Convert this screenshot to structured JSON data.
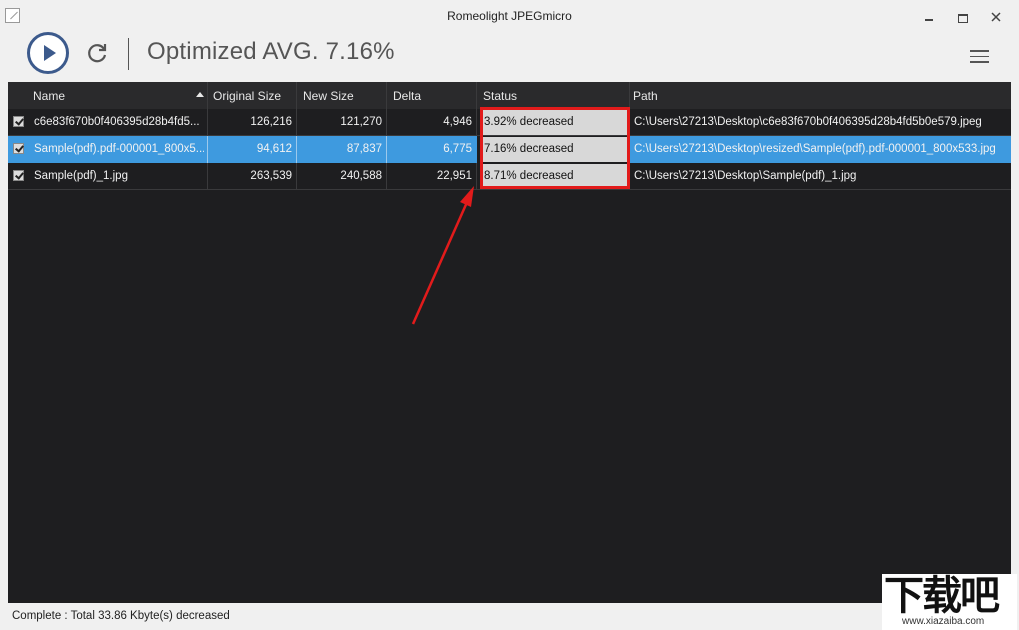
{
  "window": {
    "title": "Romeolight JPEGmicro"
  },
  "toolbar": {
    "title": "Optimized AVG. 7.16%",
    "icons": [
      "play-icon",
      "refresh-icon",
      "menu-icon"
    ]
  },
  "grid": {
    "columns": [
      "Name",
      "Original Size",
      "New Size",
      "Delta",
      "Status",
      "Path"
    ],
    "sort_column": "Original Size",
    "rows": [
      {
        "checked": true,
        "name": "c6e83f670b0f406395d28b4fd5...",
        "original_size": "126,216",
        "new_size": "121,270",
        "delta": "4,946",
        "status": "3.92% decreased",
        "path": "C:\\Users\\27213\\Desktop\\c6e83f670b0f406395d28b4fd5b0e579.jpeg"
      },
      {
        "checked": true,
        "selected": true,
        "name": "Sample(pdf).pdf-000001_800x5...",
        "original_size": "94,612",
        "new_size": "87,837",
        "delta": "6,775",
        "status": "7.16% decreased",
        "path": "C:\\Users\\27213\\Desktop\\resized\\Sample(pdf).pdf-000001_800x533.jpg"
      },
      {
        "checked": true,
        "name": "Sample(pdf)_1.jpg",
        "original_size": "263,539",
        "new_size": "240,588",
        "delta": "22,951",
        "status": "8.71% decreased",
        "path": "C:\\Users\\27213\\Desktop\\Sample(pdf)_1.jpg"
      }
    ]
  },
  "annotation_color": "#e21b1b",
  "selection_color": "#3e9adf",
  "statusbar": {
    "text": "Complete : Total 33.86 Kbyte(s) decreased"
  },
  "watermark": {
    "chars": "下载吧",
    "url": "www.xiazaiba.com"
  }
}
